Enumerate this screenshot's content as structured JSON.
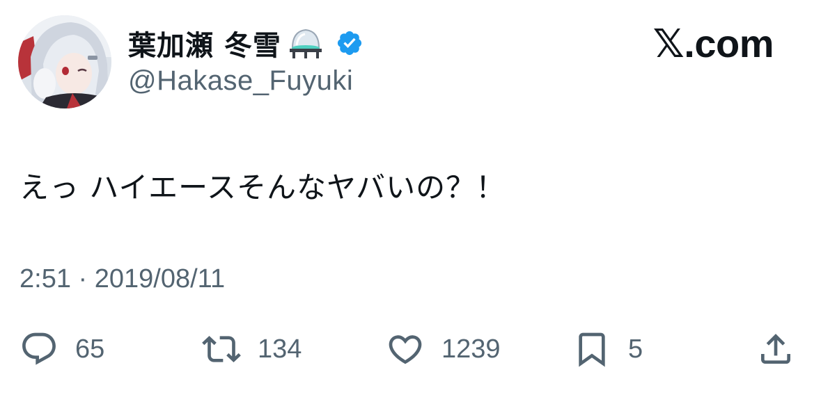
{
  "author": {
    "display_name": "葉加瀬 冬雪",
    "name_emoji": "flask-emoji",
    "verified_icon": "verified-badge-icon",
    "handle": "@Hakase_Fuyuki"
  },
  "brand": {
    "label": "𝕏.com"
  },
  "tweet": {
    "text": "えっ ハイエースそんなヤバいの？！",
    "timestamp": "2:51 · 2019/08/11"
  },
  "actions": {
    "reply": {
      "icon": "reply-icon",
      "count": "65"
    },
    "retweet": {
      "icon": "retweet-icon",
      "count": "134"
    },
    "like": {
      "icon": "heart-icon",
      "count": "1239"
    },
    "bookmark": {
      "icon": "bookmark-icon",
      "count": "5"
    },
    "share": {
      "icon": "share-icon"
    }
  },
  "colors": {
    "text_primary": "#0f1419",
    "text_secondary": "#536471",
    "verified_blue": "#1d9bf0"
  }
}
